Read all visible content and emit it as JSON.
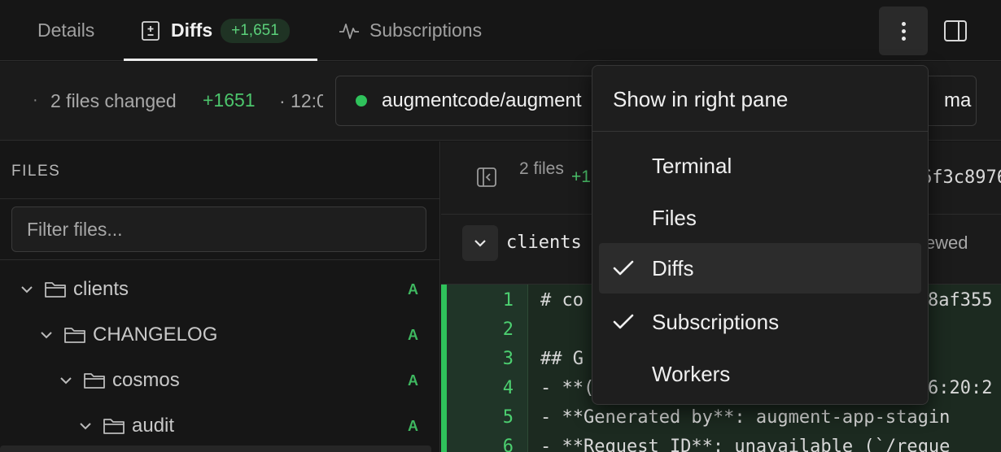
{
  "tabs": {
    "details": "Details",
    "diffs": "Diffs",
    "diffs_badge": "+1,651",
    "subscriptions": "Subscriptions"
  },
  "summary": {
    "separator": "·",
    "files_changed": "2 files changed",
    "additions": "+1651",
    "time_prefix": "· 12:0",
    "repo": "augmentcode/augment",
    "branch": "ma"
  },
  "sidebar": {
    "label": "FILES",
    "filter_placeholder": "Filter files...",
    "tree": [
      {
        "name": "clients",
        "status": "A",
        "depth": 0
      },
      {
        "name": "CHANGELOG",
        "status": "A",
        "depth": 1
      },
      {
        "name": "cosmos",
        "status": "A",
        "depth": 2
      },
      {
        "name": "audit",
        "status": "A",
        "depth": 3
      }
    ]
  },
  "diff": {
    "files_count": "2 files",
    "additions": "+1",
    "commit": "6f3c8976",
    "file_name": "clients",
    "viewed": "iewed",
    "lines": [
      {
        "n": "1",
        "text": "# co",
        "tail": "8af355"
      },
      {
        "n": "2",
        "text": "",
        "tail": ""
      },
      {
        "n": "3",
        "text": "## G",
        "tail": ""
      },
      {
        "n": "4",
        "text": "- **(",
        "tail": "6:20:2"
      },
      {
        "n": "5",
        "text": "- **Generated by**: augment-app-stagin",
        "tail": ""
      },
      {
        "n": "6",
        "text": "- **Request ID**: unavailable (`/reque",
        "tail": ""
      }
    ]
  },
  "menu": {
    "title": "Show in right pane",
    "items": [
      {
        "label": "Terminal",
        "checked": false
      },
      {
        "label": "Files",
        "checked": false
      },
      {
        "label": "Diffs",
        "checked": true
      },
      {
        "label": "Subscriptions",
        "checked": true
      },
      {
        "label": "Workers",
        "checked": false
      }
    ]
  },
  "colors": {
    "accent_green": "#4cc56c",
    "menu_bg": "#1e1e1e",
    "page_bg": "#161616"
  }
}
